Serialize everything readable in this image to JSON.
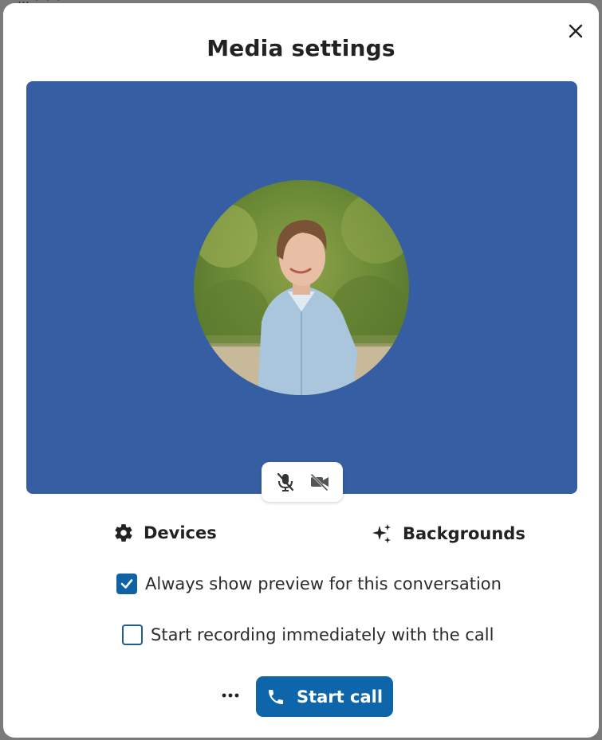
{
  "backdrop": {
    "partial_text": "… • • •"
  },
  "dialog": {
    "title": "Media settings",
    "close_icon": "close-icon"
  },
  "preview": {
    "background_color": "#365fa3",
    "avatar_description_icon": "user-avatar",
    "toggles": {
      "microphone": {
        "icon": "microphone-off-icon",
        "state": "off"
      },
      "camera": {
        "icon": "camera-off-icon",
        "state": "off"
      }
    }
  },
  "tabs": [
    {
      "label": "Devices",
      "icon": "gear-icon"
    },
    {
      "label": "Backgrounds",
      "icon": "sparkles-icon"
    }
  ],
  "options": [
    {
      "label": "Always show preview for this conversation",
      "checked": true
    },
    {
      "label": "Start recording immediately with the call",
      "checked": false
    }
  ],
  "footer": {
    "more_icon": "more-horizontal-icon",
    "start_call_label": "Start call",
    "start_call_icon": "phone-icon",
    "accent_color": "#0e65a9"
  }
}
